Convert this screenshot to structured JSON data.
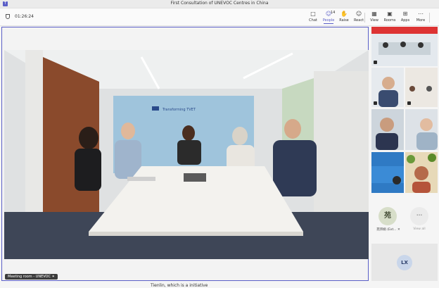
{
  "window": {
    "title": "First Consultation of UNEVOC Centres in China"
  },
  "toolbar": {
    "timer": "01:26:24",
    "people_count": "14",
    "buttons": [
      {
        "label": "Chat",
        "icon": "chat-icon"
      },
      {
        "label": "People",
        "icon": "people-icon"
      },
      {
        "label": "Raise",
        "icon": "raise-hand-icon"
      },
      {
        "label": "React",
        "icon": "react-icon"
      },
      {
        "label": "View",
        "icon": "view-icon"
      },
      {
        "label": "Rooms",
        "icon": "rooms-icon"
      },
      {
        "label": "Apps",
        "icon": "apps-icon"
      },
      {
        "label": "More",
        "icon": "more-icon"
      }
    ]
  },
  "stage": {
    "meeting_label": "Meeting room - UNEVOC",
    "wall_sign": "Transforming TVET"
  },
  "sidebar": {
    "participant_initial": "苑",
    "participant_name": "苑邦娟 (Ext...",
    "view_all": "View all",
    "lx_initials": "LX"
  },
  "bottom_text": "Tienlin, which is a initiative",
  "colors": {
    "accent": "#5b5fc7"
  }
}
